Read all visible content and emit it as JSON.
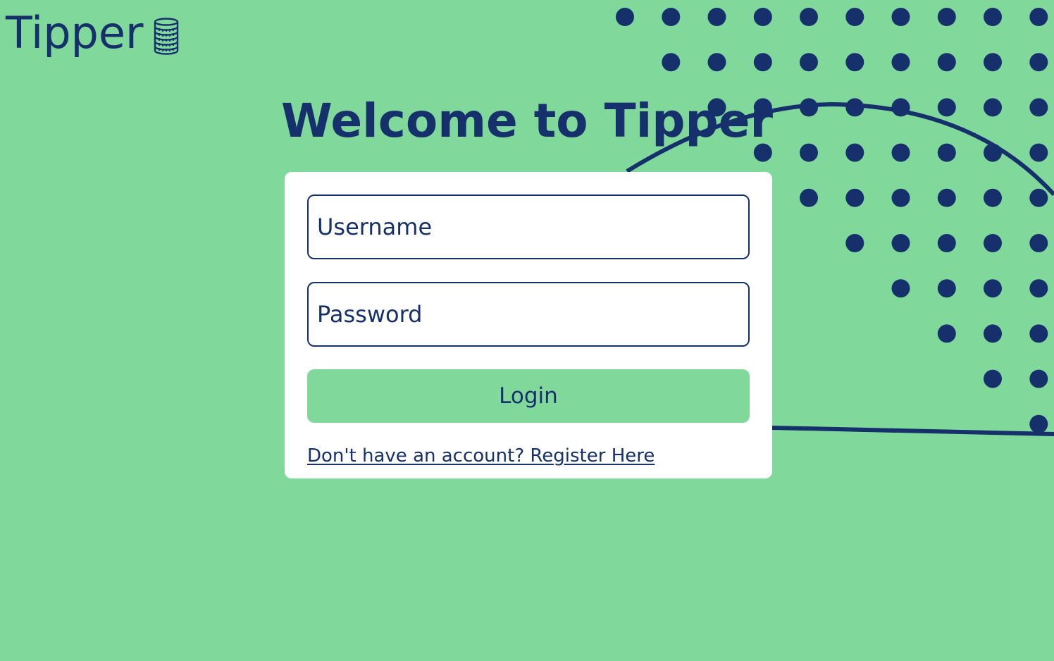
{
  "brand": {
    "name": "Tipper",
    "icon": "coin-stack-icon"
  },
  "page": {
    "heading": "Welcome to Tipper"
  },
  "login_form": {
    "username_placeholder": "Username",
    "username_value": "",
    "password_placeholder": "Password",
    "password_value": "",
    "login_label": "Login",
    "register_link": "Don't have an account? Register Here"
  },
  "colors": {
    "background": "#80d99b",
    "primary": "#15306b",
    "card": "#ffffff",
    "button": "#80d99b"
  }
}
